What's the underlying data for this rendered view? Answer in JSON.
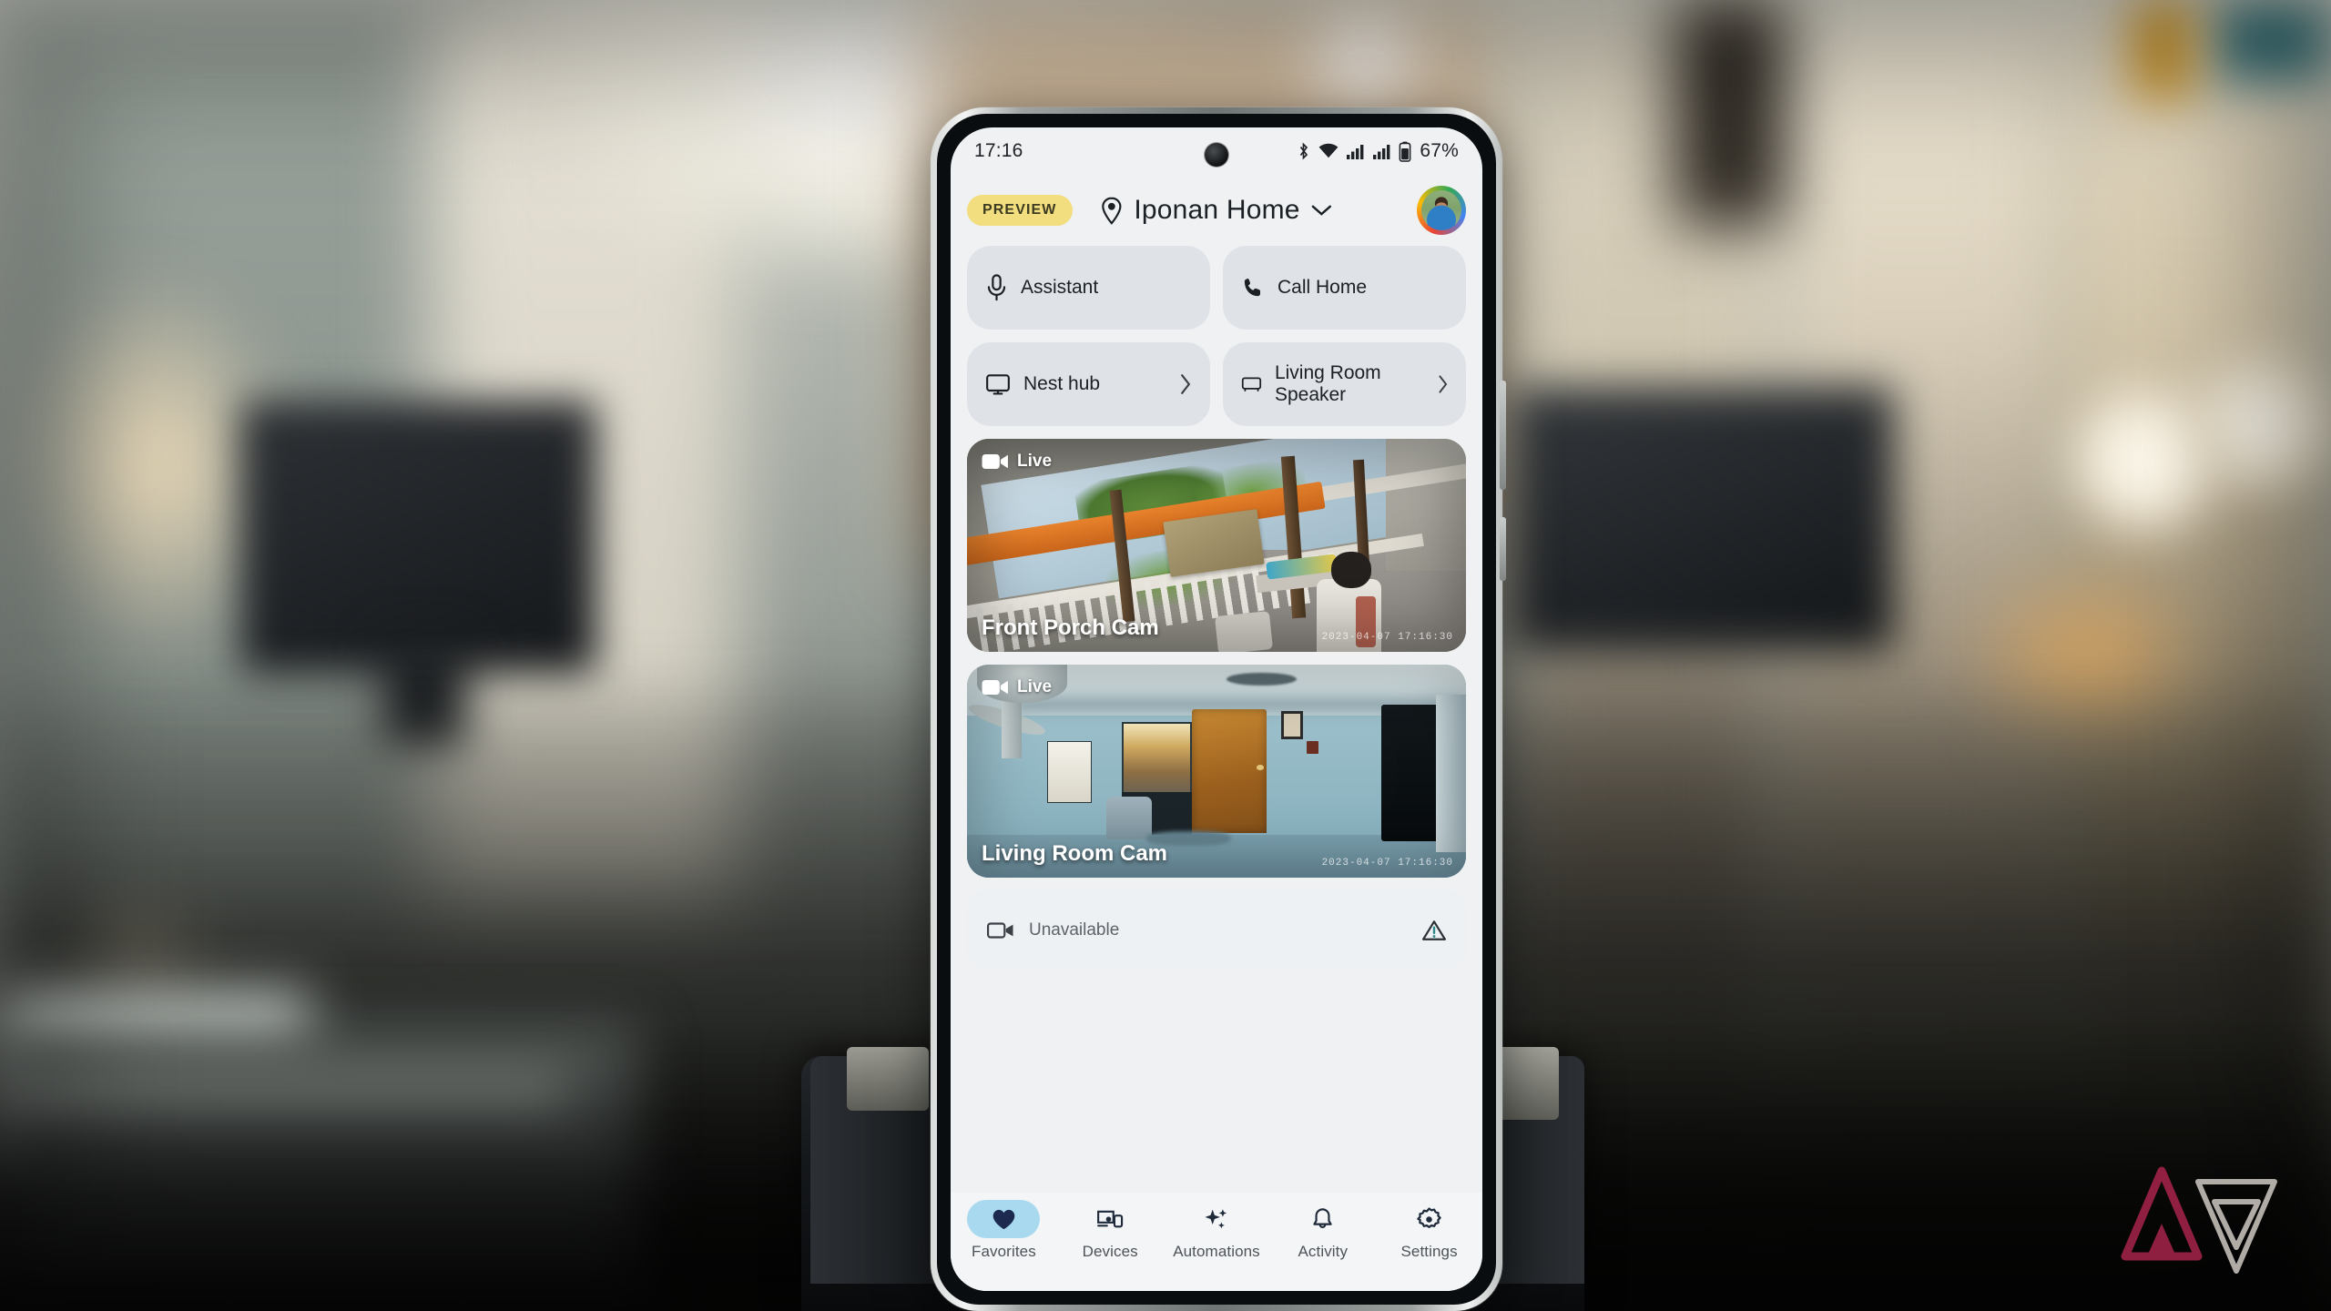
{
  "device": {
    "status_bar": {
      "time": "17:16",
      "battery_percent": "67%",
      "icons": [
        "bluetooth-icon",
        "wifi-icon",
        "signal-icon",
        "signal-icon",
        "battery-icon"
      ]
    }
  },
  "app": {
    "header": {
      "preview_badge": "PREVIEW",
      "home_name": "Iponan Home",
      "location_icon": "location-pin-icon",
      "dropdown_icon": "chevron-down-icon",
      "avatar": "account-avatar"
    },
    "tiles": [
      {
        "label": "Assistant",
        "icon": "microphone-icon",
        "chevron": ""
      },
      {
        "label": "Call Home",
        "icon": "phone-icon",
        "chevron": ""
      },
      {
        "label": "Nest hub",
        "icon": "display-icon",
        "chevron": "›"
      },
      {
        "label": "Living Room Speaker",
        "icon": "speaker-icon",
        "chevron": "›"
      }
    ],
    "cameras": [
      {
        "name": "Front Porch Cam",
        "status": "Live",
        "status_icon": "video-camera-icon",
        "timestamp": "2023-04-07  17:16:30"
      },
      {
        "name": "Living Room Cam",
        "status": "Live",
        "status_icon": "video-camera-icon",
        "timestamp": "2023-04-07  17:16:30"
      }
    ],
    "unavailable": {
      "label": "Unavailable",
      "icon": "video-camera-off-icon",
      "warning_icon": "warning-triangle-icon"
    },
    "bottom_nav": {
      "items": [
        {
          "label": "Favorites",
          "icon": "heart-icon",
          "active": true
        },
        {
          "label": "Devices",
          "icon": "devices-icon",
          "active": false
        },
        {
          "label": "Automations",
          "icon": "sparkles-icon",
          "active": false
        },
        {
          "label": "Activity",
          "icon": "bell-icon",
          "active": false
        },
        {
          "label": "Settings",
          "icon": "gear-icon",
          "active": false
        }
      ]
    }
  },
  "colors": {
    "preview_badge_bg": "#f2de7e",
    "tile_bg": "#dfe3e8",
    "screen_bg": "#eff1f3",
    "nav_active_pill": "#a8d9ef",
    "nav_bg": "#f3f5f7",
    "text_primary": "#1b2024",
    "text_muted": "#5c6369"
  },
  "watermark": {
    "name": "android-police-logo"
  }
}
